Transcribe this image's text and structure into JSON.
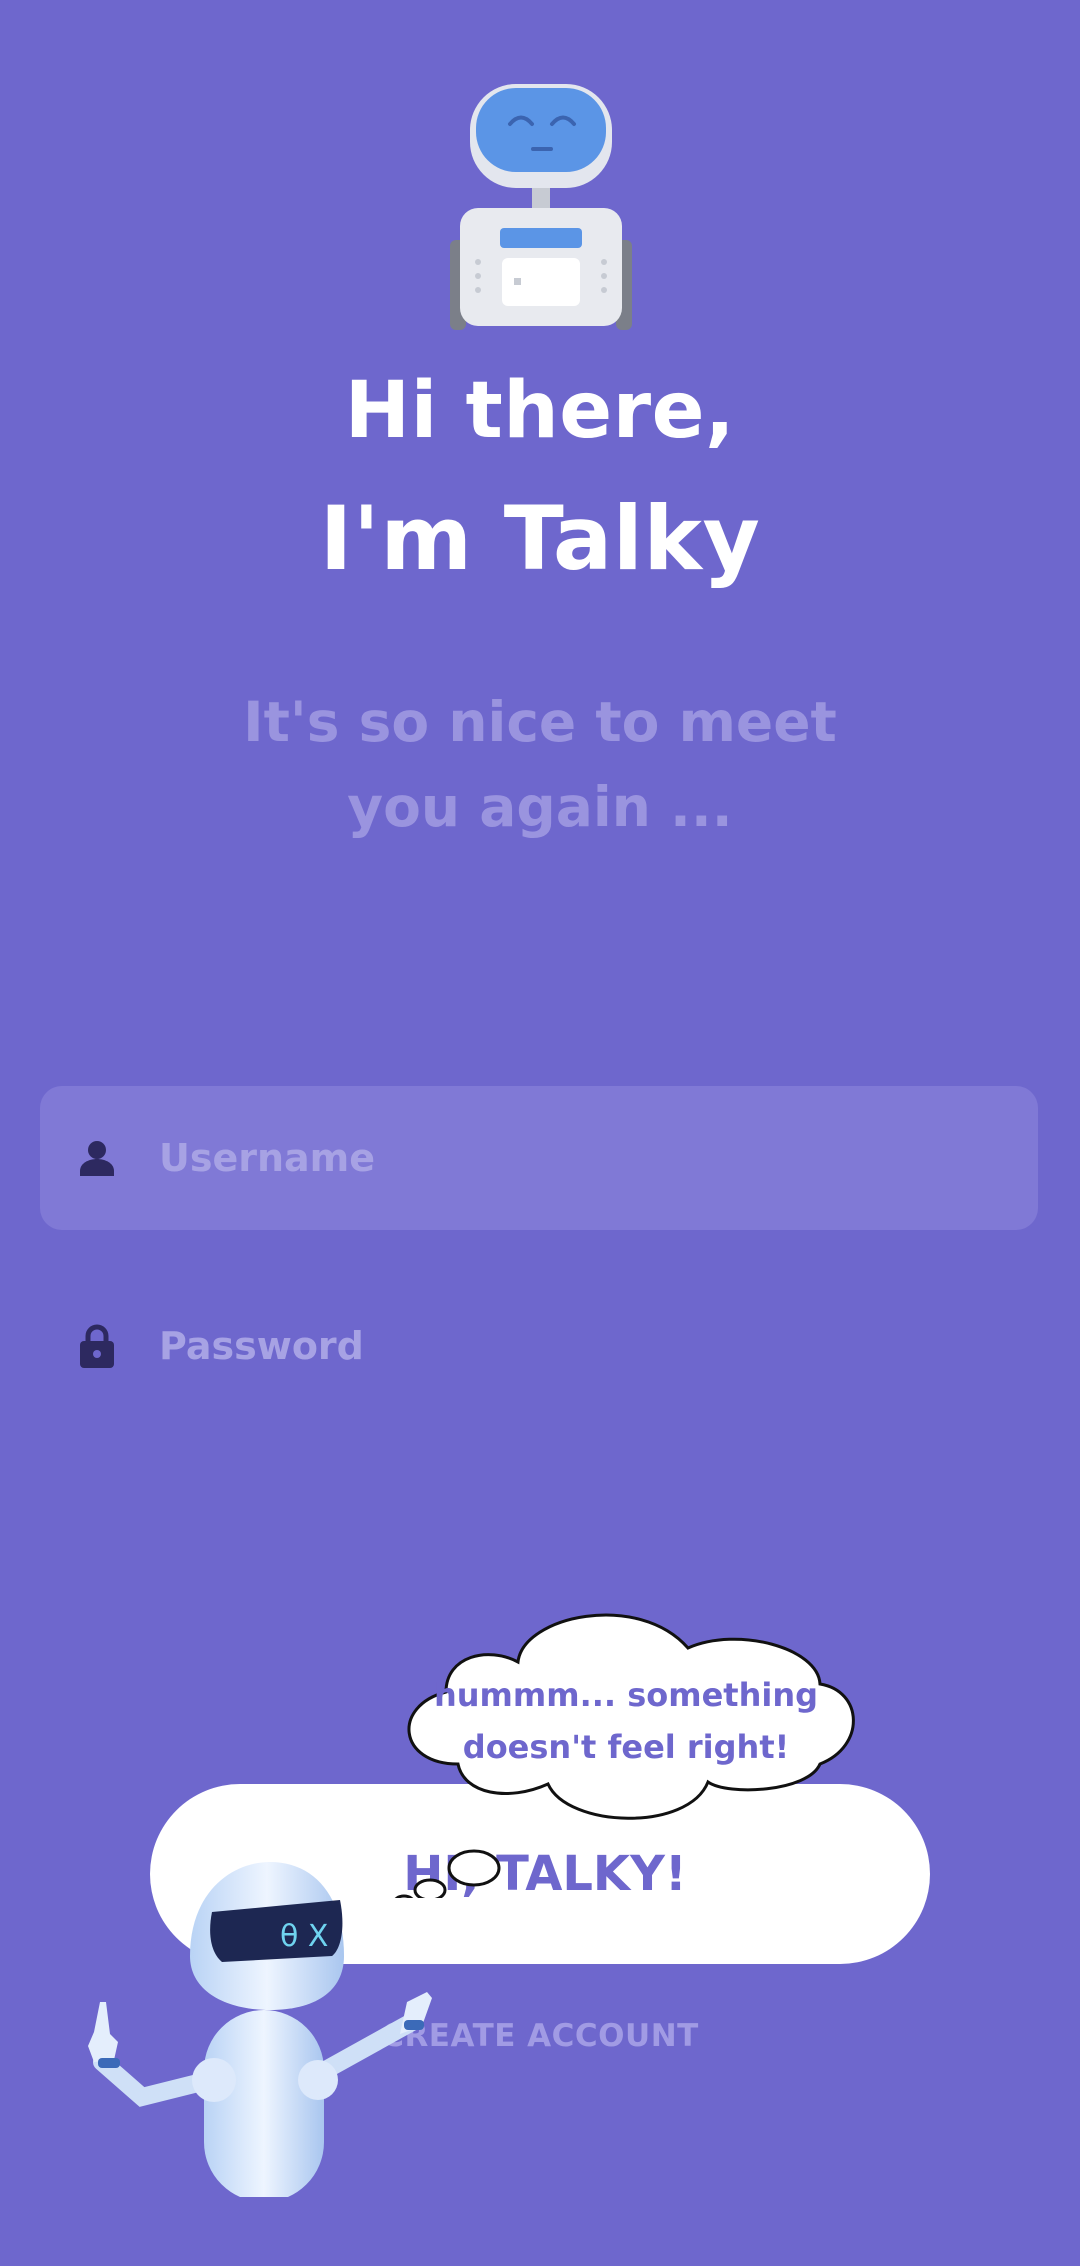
{
  "header": {
    "title_line1": "Hi there,",
    "title_line2": "I'm Talky",
    "subtitle_line1": "It's so nice to meet",
    "subtitle_line2": "you again ..."
  },
  "form": {
    "username": {
      "placeholder": "Username",
      "value": ""
    },
    "password": {
      "placeholder": "Password",
      "value": ""
    }
  },
  "actions": {
    "primary_label": "HI, TALKY!",
    "secondary_label": "CREATE ACCOUNT"
  },
  "mascot": {
    "thought_line1": "hummm... something",
    "thought_line2": "doesn't feel right!",
    "visor_text": "θ X"
  },
  "icons": {
    "username": "person-icon",
    "password": "lock-icon"
  },
  "colors": {
    "background": "#6e67cd",
    "accent": "#6e67cd",
    "input_fill": "#8079d6",
    "subtitle": "#9a94df",
    "button": "#ffffff"
  }
}
